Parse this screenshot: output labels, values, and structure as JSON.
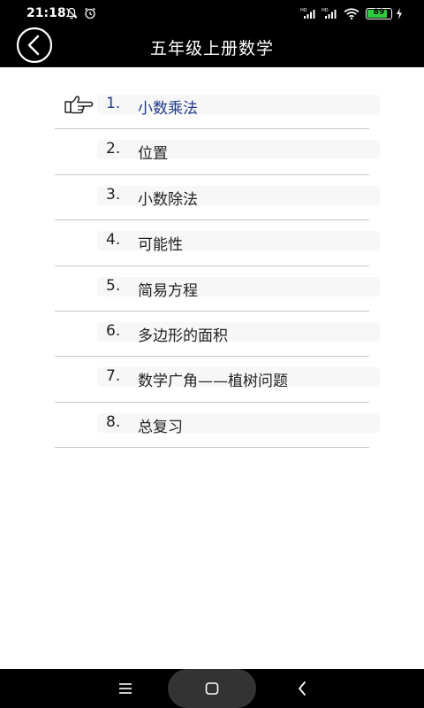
{
  "status_bar": {
    "time": "21:18",
    "battery": "89",
    "battery_level_percent": 89,
    "icons": [
      "notifications-off-icon",
      "alarm-icon",
      "signal-hd-icon",
      "signal-hd-icon",
      "wifi-icon",
      "battery-icon",
      "charging-icon"
    ]
  },
  "header": {
    "title": "五年级上册数学",
    "back_icon": "back-arrow-icon"
  },
  "menu": {
    "selected_index": 0,
    "items": [
      {
        "num": "1.",
        "label": "小数乘法"
      },
      {
        "num": "2.",
        "label": "位置"
      },
      {
        "num": "3.",
        "label": "小数除法"
      },
      {
        "num": "4.",
        "label": "可能性"
      },
      {
        "num": "5.",
        "label": "简易方程"
      },
      {
        "num": "6.",
        "label": "多边形的面积"
      },
      {
        "num": "7.",
        "label": "数学广角——植树问题"
      },
      {
        "num": "8.",
        "label": "总复习"
      }
    ]
  },
  "nav_bar": {
    "icons": [
      "menu-icon",
      "home-icon",
      "back-icon"
    ]
  },
  "colors": {
    "bar_background": "#000000",
    "selected_text": "#1e3a8a",
    "divider": "#c8c8c8",
    "battery_fill": "#2ecc40"
  }
}
